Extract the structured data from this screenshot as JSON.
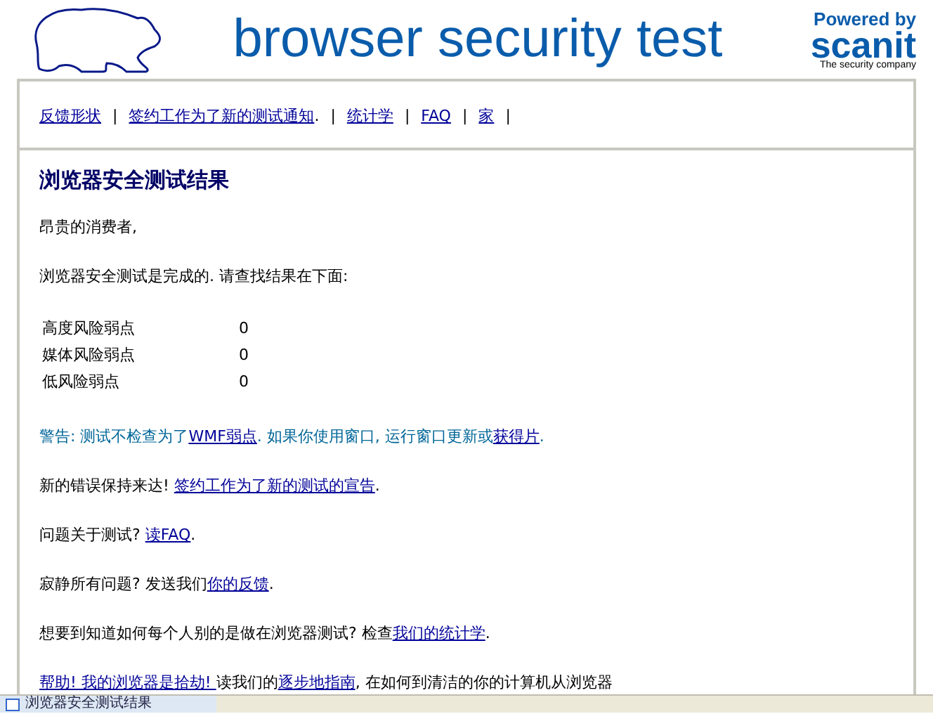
{
  "header": {
    "title": "browser security test",
    "powered_by": "Powered by",
    "brand": "scanit",
    "tagline": "The security company"
  },
  "nav": [
    {
      "kind": "link",
      "text": "反馈形状"
    },
    {
      "kind": "separator",
      "text": "|"
    },
    {
      "kind": "link",
      "text": "签约工作为了新的测试通知"
    },
    {
      "kind": "text",
      "text": "."
    },
    {
      "kind": "separator",
      "text": "|"
    },
    {
      "kind": "link",
      "text": "统计学"
    },
    {
      "kind": "separator",
      "text": "|"
    },
    {
      "kind": "link",
      "text": "FAQ"
    },
    {
      "kind": "separator",
      "text": "|"
    },
    {
      "kind": "link",
      "text": "家"
    },
    {
      "kind": "separator",
      "text": "|"
    }
  ],
  "heading": "浏览器安全测试结果",
  "greeting": "昂贵的消费者,",
  "intro": "浏览器安全测试是完成的. 请查找结果在下面:",
  "results": [
    {
      "label": "高度风险弱点",
      "count": "0"
    },
    {
      "label": "媒体风险弱点",
      "count": "0"
    },
    {
      "label": "低风险弱点",
      "count": "0"
    }
  ],
  "paragraphs": [
    {
      "kind": "warning",
      "parts": [
        {
          "kind": "text",
          "text": "警告: 测试不检查为了"
        },
        {
          "kind": "link",
          "text": "WMF弱点"
        },
        {
          "kind": "text",
          "text": ". 如果你使用窗口, 运行窗口更新或"
        },
        {
          "kind": "link",
          "text": "获得片"
        },
        {
          "kind": "text",
          "text": "."
        }
      ]
    },
    {
      "kind": "normal",
      "parts": [
        {
          "kind": "text",
          "text": "新的错误保持来达! "
        },
        {
          "kind": "link",
          "text": "签约工作为了新的测试的宣告"
        },
        {
          "kind": "text",
          "text": "."
        }
      ]
    },
    {
      "kind": "normal",
      "parts": [
        {
          "kind": "text",
          "text": "问题关于测试? "
        },
        {
          "kind": "link",
          "text": "读FAQ"
        },
        {
          "kind": "text",
          "text": "."
        }
      ]
    },
    {
      "kind": "normal",
      "parts": [
        {
          "kind": "text",
          "text": "寂静所有问题? 发送我们"
        },
        {
          "kind": "link",
          "text": "你的反馈"
        },
        {
          "kind": "text",
          "text": "."
        }
      ]
    },
    {
      "kind": "normal",
      "parts": [
        {
          "kind": "text",
          "text": "想要到知道如何每个人别的是做在浏览器测试? 检查"
        },
        {
          "kind": "link",
          "text": "我们的统计学"
        },
        {
          "kind": "text",
          "text": "."
        }
      ]
    },
    {
      "kind": "normal",
      "parts": [
        {
          "kind": "link",
          "text": "帮助! 我的浏览器是拾劫! "
        },
        {
          "kind": "text",
          "text": "读我们的"
        },
        {
          "kind": "link",
          "text": "逐步地指南"
        },
        {
          "kind": "text",
          "text": ", 在如何到清洁的你的计算机从浏览器"
        }
      ]
    }
  ],
  "status_bar": {
    "text": "浏览器安全测试结果"
  }
}
